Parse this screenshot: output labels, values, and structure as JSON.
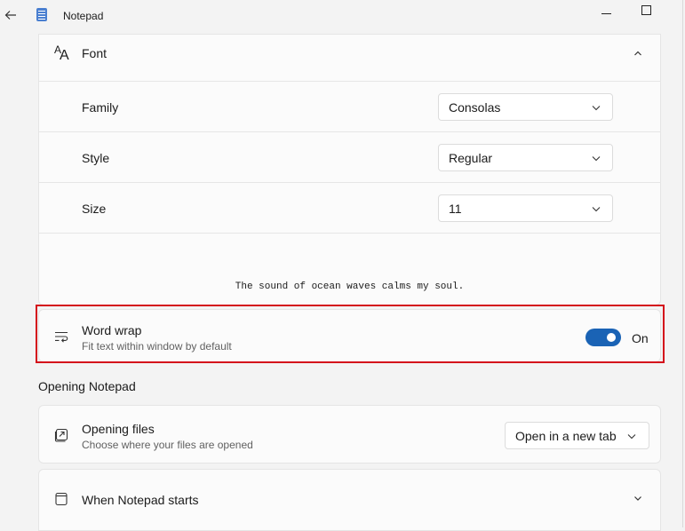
{
  "window": {
    "title": "Notepad"
  },
  "font": {
    "header": "Font",
    "family": {
      "label": "Family",
      "value": "Consolas"
    },
    "style": {
      "label": "Style",
      "value": "Regular"
    },
    "size": {
      "label": "Size",
      "value": "11"
    },
    "preview": "The sound of ocean waves calms my soul."
  },
  "word_wrap": {
    "title": "Word wrap",
    "description": "Fit text within window by default",
    "state": "On",
    "enabled": true
  },
  "opening_section": {
    "title": "Opening Notepad",
    "opening_files": {
      "title": "Opening files",
      "description": "Choose where your files are opened",
      "value": "Open in a new tab"
    },
    "when_starts": {
      "title": "When Notepad starts"
    }
  },
  "colors": {
    "accent": "#1a63b5",
    "highlight": "#d40f1b"
  },
  "icons": [
    "back-arrow-icon",
    "notepad-app-icon",
    "minimize-icon",
    "maximize-icon",
    "font-icon",
    "chevron-up-icon",
    "chevron-down-icon",
    "word-wrap-icon",
    "open-files-icon",
    "notepad-start-icon"
  ]
}
